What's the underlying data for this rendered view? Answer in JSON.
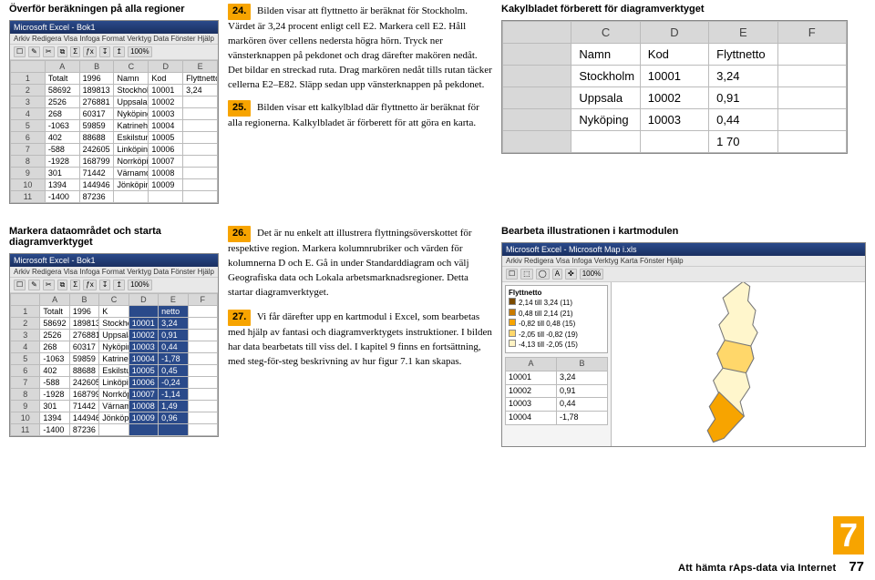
{
  "row1": {
    "left_heading": "Överför beräkningen på alla regioner",
    "right_heading": "Kakylbladet förberett för diagramverktyget",
    "step24_num": "24.",
    "step24_text": "Bilden visar att flyttnetto är beräknat för Stockholm. Värdet är 3,24 procent enligt cell E2. Markera cell E2. Håll markören över cellens nedersta högra hörn. Tryck ner vänsterknappen på pekdonet och drag därefter makören nedåt. Det bildar en streckad ruta. Drag markören nedåt tills rutan täcker cellerna E2–E82. Släpp sedan upp vänsterknappen på pekdonet.",
    "step25_num": "25.",
    "step25_text": "Bilden visar ett kalkylblad där flyttnetto är beräknat för alla regionerna. Kalkylbladet är förberett för att göra en karta.",
    "sheet1": {
      "titlebar": "Microsoft Excel - Bok1",
      "menubar": "Arkiv  Redigera  Visa  Infoga  Format  Verktyg  Data  Fönster  Hjälp",
      "cols": [
        "",
        "A",
        "B",
        "C",
        "D",
        "E"
      ],
      "rows": [
        [
          "1",
          "Totalt",
          "1996",
          "Namn",
          "Kod",
          "Flyttnetto"
        ],
        [
          "2",
          "58692",
          "189813",
          "Stockholm",
          "10001",
          "3,24"
        ],
        [
          "3",
          "2526",
          "276881",
          "Uppsala",
          "10002",
          ""
        ],
        [
          "4",
          "268",
          "60317",
          "Nyköping",
          "10003",
          ""
        ],
        [
          "5",
          "-1063",
          "59859",
          "Katrineholm",
          "10004",
          ""
        ],
        [
          "6",
          "402",
          "88688",
          "Eskilstuna",
          "10005",
          ""
        ],
        [
          "7",
          "-588",
          "242605",
          "Linköping",
          "10006",
          ""
        ],
        [
          "8",
          "-1928",
          "168799",
          "Norrköping",
          "10007",
          ""
        ],
        [
          "9",
          "301",
          "71442",
          "Värnamo",
          "10008",
          ""
        ],
        [
          "10",
          "1394",
          "144946",
          "Jönköping",
          "10009",
          ""
        ],
        [
          "11",
          "-1400",
          "87236",
          "",
          "",
          ""
        ]
      ]
    },
    "sheet_big": {
      "cols": [
        "",
        "C",
        "D",
        "E",
        "F"
      ],
      "rows": [
        [
          "",
          "Namn",
          "Kod",
          "Flyttnetto",
          ""
        ],
        [
          "",
          "Stockholm",
          "10001",
          "3,24",
          ""
        ],
        [
          "",
          "Uppsala",
          "10002",
          "0,91",
          ""
        ],
        [
          "",
          "Nyköping",
          "10003",
          "0,44",
          ""
        ],
        [
          "",
          "",
          "",
          "1 70",
          ""
        ]
      ]
    }
  },
  "row2": {
    "left_heading": "Markera dataområdet och starta diagramverktyget",
    "right_heading": "Bearbeta illustrationen i kartmodulen",
    "step26_num": "26.",
    "step26_text": "Det är nu enkelt att illustrera flyttningsöverskottet för respektive region. Markera kolumnrubriker och värden för kolumnerna D och E. Gå in under Standarddiagram och välj Geografiska data och Lokala arbetsmarknadsregioner. Detta startar diagramverktyget.",
    "step27_num": "27.",
    "step27_text": "Vi får därefter upp en kartmodul i Excel, som bearbetas med hjälp av fantasi och diagramverktygets instruktioner. I bilden har data bearbetats till viss del. I kapitel 9 finns en fortsättning, med steg-för-steg beskrivning av hur figur 7.1 kan skapas.",
    "sheet2": {
      "titlebar": "Microsoft Excel - Bok1",
      "menubar": "Arkiv  Redigera  Visa  Infoga  Format  Verktyg  Data  Fönster  Hjälp",
      "cols": [
        "",
        "A",
        "B",
        "C",
        "D",
        "E",
        "F"
      ],
      "rows": [
        [
          "1",
          "Totalt",
          "1996",
          "K",
          "",
          "netto",
          ""
        ],
        [
          "2",
          "58692",
          "189813",
          "Stockholm",
          "10001",
          "3,24",
          ""
        ],
        [
          "3",
          "2526",
          "276881",
          "Uppsala",
          "10002",
          "0,91",
          ""
        ],
        [
          "4",
          "268",
          "60317",
          "Nyköping",
          "10003",
          "0,44",
          ""
        ],
        [
          "5",
          "-1063",
          "59859",
          "Katrineholm",
          "10004",
          "-1,78",
          ""
        ],
        [
          "6",
          "402",
          "88688",
          "Eskilstuna",
          "10005",
          "0,45",
          ""
        ],
        [
          "7",
          "-588",
          "242605",
          "Linköping",
          "10006",
          "-0,24",
          ""
        ],
        [
          "8",
          "-1928",
          "168799",
          "Norrköping",
          "10007",
          "-1,14",
          ""
        ],
        [
          "9",
          "301",
          "71442",
          "Värnamo",
          "10008",
          "1,49",
          ""
        ],
        [
          "10",
          "1394",
          "144946",
          "Jönköping",
          "10009",
          "0,96",
          ""
        ],
        [
          "11",
          "-1400",
          "87236",
          "",
          "",
          "",
          ""
        ]
      ],
      "sel_cols": [
        4,
        5
      ]
    },
    "map": {
      "titlebar": "Microsoft Excel - Microsoft Map i.xls",
      "menubar": "Arkiv  Redigera  Visa  Infoga  Verktyg  Karta  Fönster  Hjälp",
      "legend_title": "Flyttnetto",
      "legend": [
        "2,14 till 3,24  (11)",
        "0,48 till 2,14  (21)",
        "-0,82 till 0,48 (15)",
        "-2,05 till -0,82 (19)",
        "-4,13 till -2,05 (15)"
      ]
    }
  },
  "chapter_num": "7",
  "footer_title": "Att hämta rAps-data via Internet",
  "page_num": "77"
}
